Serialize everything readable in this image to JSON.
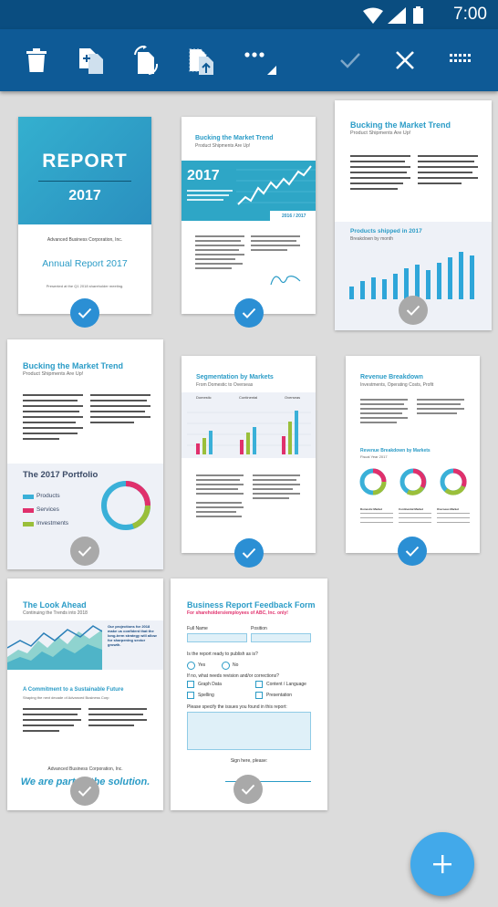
{
  "status": {
    "time": "7:00"
  },
  "toolbar": {
    "icons": [
      "trash-icon",
      "add-page-icon",
      "rotate-page-icon",
      "extract-page-icon",
      "more-icon",
      "confirm-icon",
      "close-icon",
      "grid-view-icon"
    ],
    "more_label": "•••"
  },
  "pages": {
    "p1": {
      "title": "REPORT",
      "year": "2017",
      "company": "Advanced Business Corporation, Inc.",
      "subtitle": "Annual Report 2017",
      "note": "Presented at the Q1 2018 shareholder meeting.",
      "selected": true
    },
    "p2": {
      "title": "Bucking the Market Trend",
      "subtitle": "Product Shipments Are Up!",
      "year": "2017",
      "badge": "2016 / 2017",
      "selected": true
    },
    "p3": {
      "title": "Bucking the Market Trend",
      "subtitle": "Product Shipments Are Up!",
      "chart_title": "Products shipped in 2017",
      "chart_sub": "Breakdown by month",
      "selected": false
    },
    "p4": {
      "title": "Bucking the Market Trend",
      "subtitle": "Product Shipments Are Up!",
      "portfolio_title": "The 2017 Portfolio",
      "legend": [
        "Products",
        "Services",
        "Investments"
      ],
      "selected": false
    },
    "p5": {
      "title": "Segmentation by Markets",
      "subtitle": "From Domestic to Overseas",
      "columns": [
        "Domestic",
        "Continental",
        "Overseas"
      ],
      "selected": true
    },
    "p6": {
      "title": "Revenue Breakdown",
      "subtitle": "Investments, Operating Costs, Profit",
      "chart_title": "Revenue Breakdown by Markets",
      "chart_sub": "Fiscal Year 2017",
      "markets": [
        "Domestic Market",
        "Continental Market",
        "Overseas Market"
      ],
      "selected": true
    },
    "p7": {
      "title": "The Look Ahead",
      "subtitle": "Continuing the Trends into 2018",
      "side_text": "Our projections for 2018 make us confident that the long-term strategy will allow for sharpening sector growth.",
      "commit_title": "A Commitment to a Sustainable Future",
      "commit_sub": "Shaping the next decade of Advanced Business Corp",
      "company": "Advanced Business Corporation, Inc.",
      "slogan": "We are part of the solution.",
      "selected": false
    },
    "p8": {
      "title": "Business Report Feedback Form",
      "subtitle": "For shareholders/employees of ABC, Inc. only!",
      "full_name": "Full Name",
      "position": "Position",
      "q1": "Is the report ready to publish as is?",
      "yes": "Yes",
      "no": "No",
      "q2": "If no, what needs revision and/or corrections?",
      "opt1": "Graph Data",
      "opt2": "Content / Language",
      "opt3": "Spelling",
      "opt4": "Presentation",
      "q3": "Please specify the issues you found in this report:",
      "sign": "Sign here, please:",
      "selected": false
    }
  },
  "fab": {
    "icon": "plus-icon",
    "label": "+"
  }
}
